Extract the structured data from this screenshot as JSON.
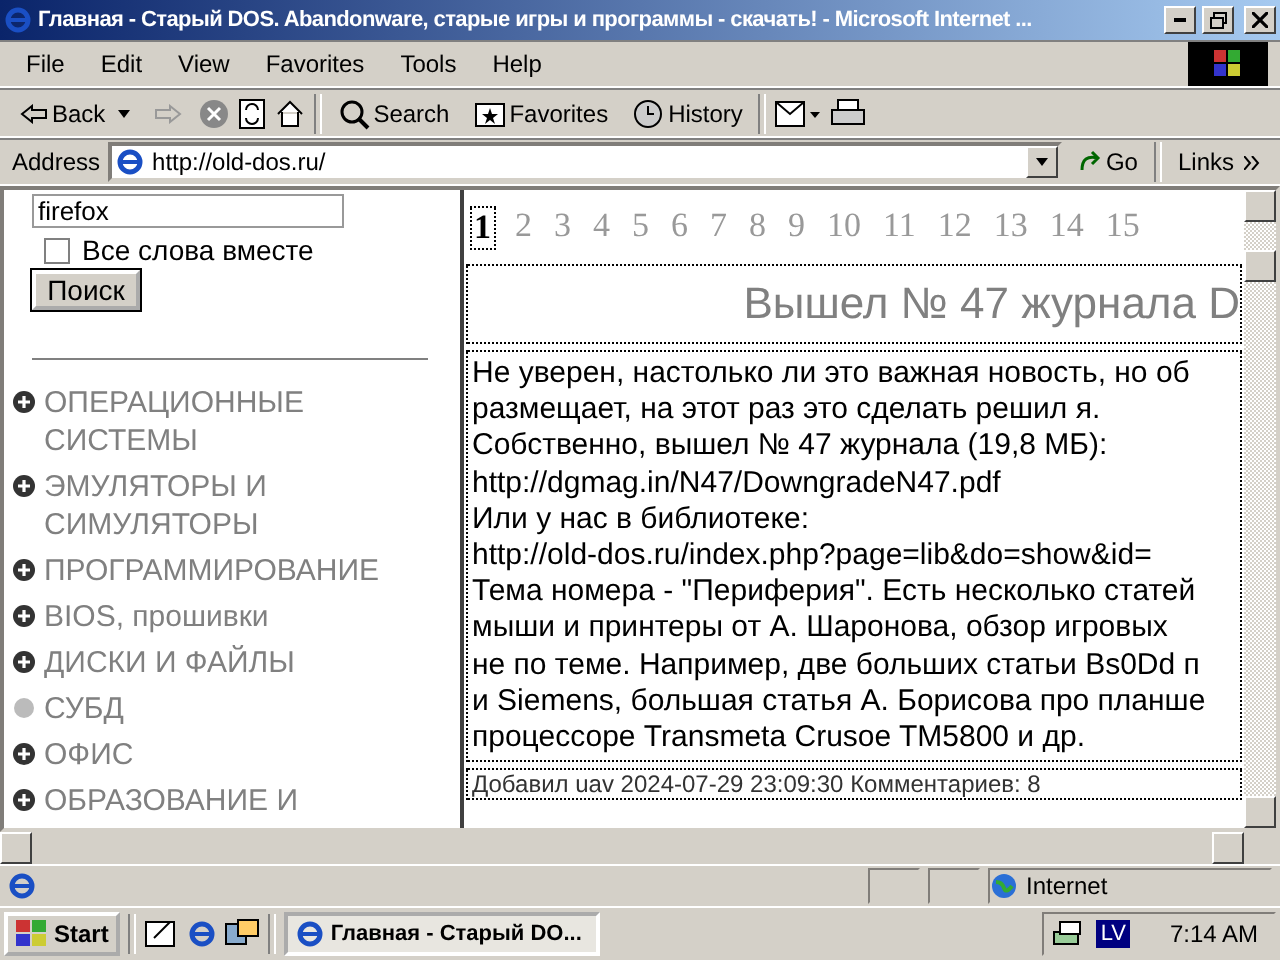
{
  "window": {
    "title": "Главная - Старый DOS. Abandonware, старые игры и программы - скачать! - Microsoft Internet ..."
  },
  "menu": [
    "File",
    "Edit",
    "View",
    "Favorites",
    "Tools",
    "Help"
  ],
  "toolbar": {
    "back": "Back",
    "search": "Search",
    "favorites": "Favorites",
    "history": "History"
  },
  "address": {
    "label": "Address",
    "value": "http://old-dos.ru/",
    "go": "Go",
    "links": "Links"
  },
  "sidebar": {
    "search_value": "firefox",
    "all_words": {
      "label": "Все слова вместе",
      "checked": false
    },
    "search_button": "Поиск",
    "categories": [
      {
        "label": "ОПЕРАЦИОННЫЕ СИСТЕМЫ",
        "kind": "expandable"
      },
      {
        "label": "ЭМУЛЯТОРЫ И СИМУЛЯТОРЫ",
        "kind": "expandable"
      },
      {
        "label": "ПРОГРАММИРОВАНИЕ",
        "kind": "expandable"
      },
      {
        "label": "BIOS, прошивки",
        "kind": "expandable"
      },
      {
        "label": "ДИСКИ И ФАЙЛЫ",
        "kind": "expandable"
      },
      {
        "label": "СУБД",
        "kind": "leaf"
      },
      {
        "label": "ОФИС",
        "kind": "expandable"
      },
      {
        "label": "ОБРАЗОВАНИЕ И",
        "kind": "expandable"
      }
    ]
  },
  "pages": [
    {
      "label": "1",
      "selected": true
    },
    {
      "label": "2",
      "selected": false
    },
    {
      "label": "3",
      "selected": false
    },
    {
      "label": "4",
      "selected": false
    },
    {
      "label": "5",
      "selected": false
    },
    {
      "label": "6",
      "selected": false
    },
    {
      "label": "7",
      "selected": false
    },
    {
      "label": "8",
      "selected": false
    },
    {
      "label": "9",
      "selected": false
    },
    {
      "label": "10",
      "selected": false
    },
    {
      "label": "11",
      "selected": false
    },
    {
      "label": "12",
      "selected": false
    },
    {
      "label": "13",
      "selected": false
    },
    {
      "label": "14",
      "selected": false
    },
    {
      "label": "15",
      "selected": false
    }
  ],
  "article": {
    "title": "Вышел № 47 журнала D",
    "lines": [
      "Не уверен, настолько ли это важная новость, но об",
      "размещает, на этот раз это сделать решил я.",
      "Собственно, вышел № 47 журнала (19,8 МБ):",
      "http://dgmag.in/N47/DowngradeN47.pdf",
      "Или у нас в библиотеке:",
      "http://old-dos.ru/index.php?page=lib&do=show&id=",
      "Тема номера - \"Периферия\". Есть несколько статей",
      "мыши и принтеры от А. Шаронова, обзор игровых",
      "не по теме. Например, две больших статьи Bs0Dd п",
      "и Siemens, большая статья А. Борисова про планше",
      "процессоре Transmeta Crusoe TM5800 и др."
    ],
    "footer": "Добавил uav 2024-07-29 23:09:30 Комментариев: 8"
  },
  "status_bar": {
    "zone": "Internet"
  },
  "taskbar": {
    "start": "Start",
    "task": "Главная - Старый DO...",
    "lang": "LV",
    "clock": "7:14 AM"
  }
}
